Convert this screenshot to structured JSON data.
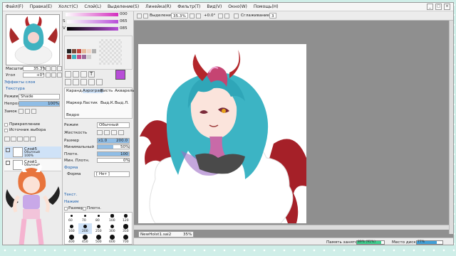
{
  "menu": [
    "Файл(F)",
    "Правка(E)",
    "Холст(C)",
    "Слой(L)",
    "Выделение(S)",
    "Линейка(R)",
    "Фильтр(T)",
    "Вид(V)",
    "Окно(W)",
    "Помощь(H)"
  ],
  "window_controls": [
    "_",
    "□",
    "×"
  ],
  "navigator": {
    "scale_label": "Масштаб",
    "scale_value": "35.3%",
    "angle_label": "Угол",
    "angle_value": "+0°"
  },
  "layer_effects": {
    "header": "Эффекты слоя",
    "texture_label": "Текстура",
    "mode_label": "Режим",
    "mode_value": "Shade",
    "opacity_label": "Непроз.",
    "opacity_value": "100%",
    "lock_label": "Замок",
    "clip_label": "Прикрепление",
    "source_label": "Источник выбора"
  },
  "layers": [
    {
      "name": "Слой5",
      "sub": "Обычный",
      "pct": "100%"
    },
    {
      "name": "Слой1",
      "sub": "Обычный",
      "pct": "100%"
    }
  ],
  "colors": {
    "slider_h": "000",
    "slider_s": "065",
    "slider_v": "085",
    "v_label": "V",
    "s_label": "S",
    "current": "#b84ed8",
    "accent": "#3fa0d8"
  },
  "tools": {
    "row1": [
      "Каранд.",
      "Аэрограф",
      "Кисть",
      "Акварель"
    ],
    "row2": [
      "Маркер",
      "Ластик",
      "Выд.К.",
      "Выд.Л."
    ],
    "row3": [
      "Ведро",
      "",
      "",
      ""
    ]
  },
  "brush": {
    "mode_label": "Режим",
    "mode_value": "Обычный",
    "hardness_label": "Жесткость",
    "size_label": "Размер",
    "size_mult": "x1.0",
    "size_value": "200.0",
    "min_size_label": "Минимальный",
    "min_size_value": "50%",
    "density_label": "Плотн.",
    "density_value": "100",
    "min_density_label": "Мин. Плотн.",
    "min_density_value": "0%",
    "shape_header": "Форма",
    "shape_label": "Форма",
    "shape_value": "[ Нет ]",
    "texture_header": "Текст.",
    "pressure_header": "Нажим",
    "pressure_size": "Размер",
    "pressure_density": "Плотн.",
    "sizes": [
      "60",
      "70",
      "80",
      "100",
      "120",
      "160",
      "200",
      "250",
      "300",
      "350",
      "400",
      "450",
      "500",
      "600",
      "700"
    ]
  },
  "topbar": {
    "selection_label": "Выделение",
    "zoom_value": "35.3%",
    "angle_value": "+0.0°",
    "smoothing_label": "Сглаживание",
    "smoothing_value": "3"
  },
  "document": {
    "name": "NewHolst1.sai2",
    "zoom": "35%"
  },
  "status": {
    "memory_label": "Память занято",
    "memory_value": "89% (91%)",
    "memory_fill": 0.89,
    "disk_label": "Место диска",
    "disk_value": "77%",
    "disk_fill": 0.77
  }
}
